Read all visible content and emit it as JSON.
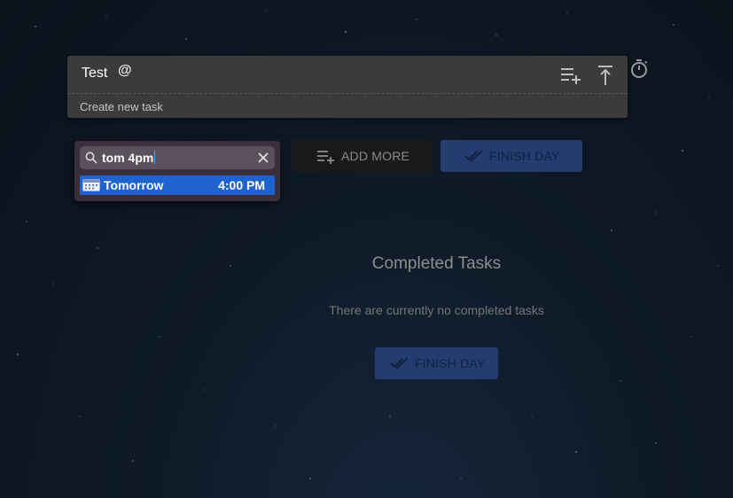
{
  "task_card": {
    "title": "Test",
    "mention_symbol": "@",
    "create_placeholder": "Create new task",
    "icons": [
      "add-to-list-icon",
      "move-to-top-icon"
    ]
  },
  "timer": {
    "icon": "stopwatch-icon"
  },
  "autocomplete": {
    "query": "tom 4pm",
    "suggestion": {
      "label": "Tomorrow",
      "time": "4:00 PM",
      "icon": "calendar-icon"
    }
  },
  "actions": {
    "add_more_label": "ADD MORE",
    "finish_day_label": "FINISH DAY"
  },
  "completed": {
    "heading": "Completed Tasks",
    "empty_message": "There are currently no completed tasks",
    "finish_day_label": "FINISH DAY"
  },
  "colors": {
    "accent_button": "#243c6f",
    "selection": "#1f63d1",
    "card": "#3b3b3d"
  }
}
